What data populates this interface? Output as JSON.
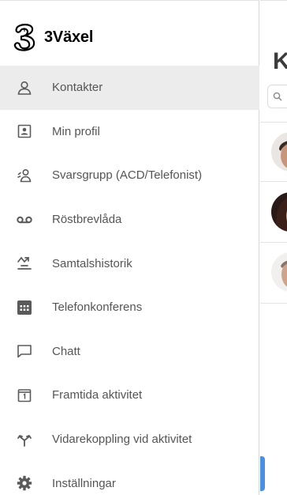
{
  "brand": {
    "name": "3Växel",
    "logo_icon": "three-logo-icon"
  },
  "menu": {
    "items": [
      {
        "label": "Kontakter",
        "icon": "contacts-icon",
        "active": true
      },
      {
        "label": "Min profil",
        "icon": "profile-card-icon",
        "active": false
      },
      {
        "label": "Svarsgrupp (ACD/Telefonist)",
        "icon": "group-icon",
        "active": false
      },
      {
        "label": "Röstbrevlåda",
        "icon": "voicemail-icon",
        "active": false
      },
      {
        "label": "Samtalshistorik",
        "icon": "call-history-icon",
        "active": false
      },
      {
        "label": "Telefonkonferens",
        "icon": "conference-icon",
        "active": false
      },
      {
        "label": "Chatt",
        "icon": "chat-icon",
        "active": false
      },
      {
        "label": "Framtida aktivitet",
        "icon": "calendar-icon",
        "active": false
      },
      {
        "label": "Vidarekoppling vid aktivitet",
        "icon": "forward-icon",
        "active": false
      },
      {
        "label": "Inställningar",
        "icon": "gear-icon",
        "active": false
      }
    ]
  },
  "panel": {
    "title_visible": "K",
    "search_icon": "search-icon",
    "accent_color": "#4a90e2"
  },
  "colors": {
    "active_bg": "#ececec",
    "icon": "#5a5a5a",
    "label": "#555555"
  }
}
